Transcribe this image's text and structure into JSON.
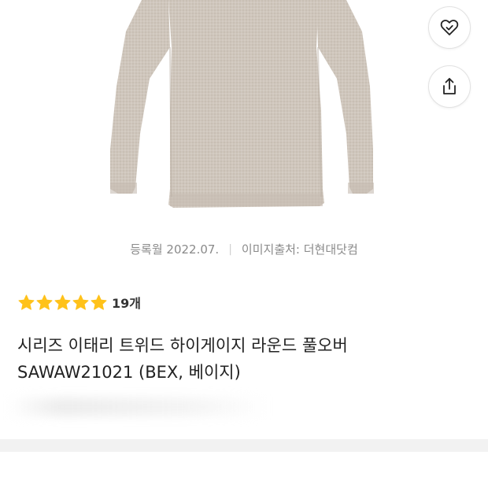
{
  "product_image": {
    "description_icon": "sweater-image"
  },
  "actions": {
    "wish_icon": "heart-check-icon",
    "share_icon": "share-icon"
  },
  "meta": {
    "registered": "등록월 2022.07.",
    "divider": "|",
    "image_source": "이미지출처: 더현대닷컴"
  },
  "rating": {
    "stars": 5,
    "star_color": "#FFC21A",
    "review_count": "19개"
  },
  "title": {
    "line1": "시리즈 이태리 트위드 하이게이지 라운드 풀오버",
    "line2": "SAWAW21021 (BEX, 베이지)"
  }
}
